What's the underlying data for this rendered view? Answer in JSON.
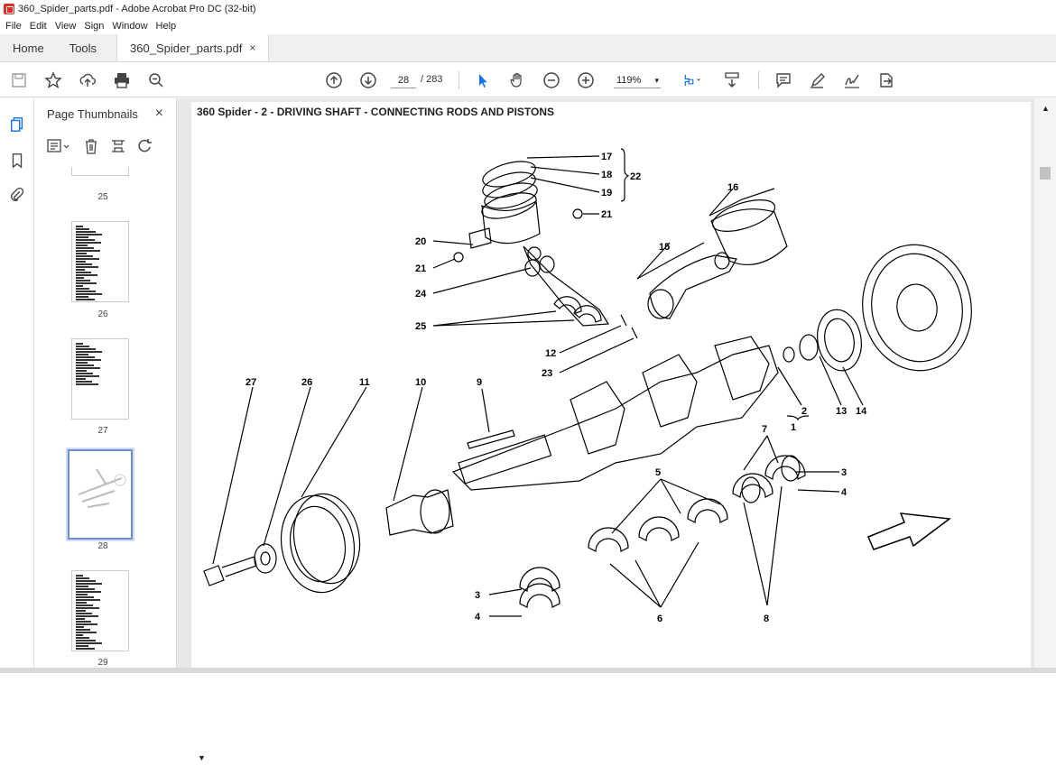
{
  "window": {
    "title": "360_Spider_parts.pdf - Adobe Acrobat Pro DC (32-bit)"
  },
  "menu": [
    "File",
    "Edit",
    "View",
    "Sign",
    "Window",
    "Help"
  ],
  "tabs": {
    "home": "Home",
    "tools": "Tools",
    "document": "360_Spider_parts.pdf",
    "close": "×"
  },
  "toolbar": {
    "page_current": "28",
    "page_total": "/ 283",
    "zoom": "119%"
  },
  "thumbnails_panel": {
    "title": "Page Thumbnails",
    "close": "×",
    "pages": [
      {
        "label": "25"
      },
      {
        "label": "26"
      },
      {
        "label": "27"
      },
      {
        "label": "28",
        "selected": true
      },
      {
        "label": "29"
      }
    ]
  },
  "document": {
    "page_heading": "360 Spider - 2 - DRIVING SHAFT - CONNECTING RODS AND PISTONS",
    "callouts": [
      "17",
      "18",
      "19",
      "22",
      "21",
      "16",
      "20",
      "21",
      "15",
      "24",
      "25",
      "12",
      "23",
      "27",
      "26",
      "11",
      "10",
      "9",
      "2",
      "1",
      "13",
      "14",
      "7",
      "3",
      "4",
      "5",
      "3",
      "4",
      "6",
      "8"
    ]
  },
  "colors": {
    "accent": "#1473e6",
    "selected_thumb": "#6a8fd0"
  }
}
